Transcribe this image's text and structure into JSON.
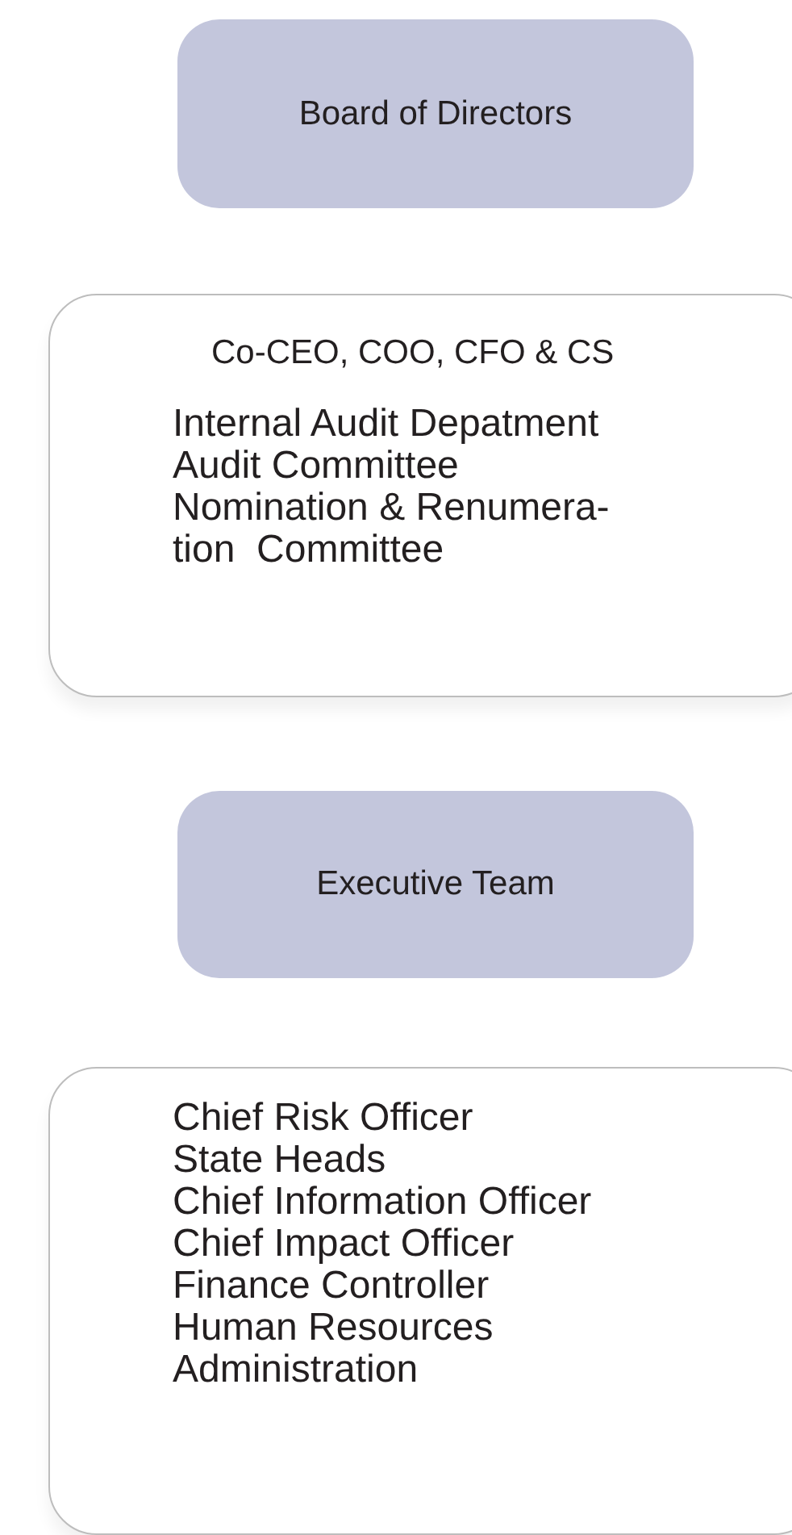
{
  "blocks": [
    {
      "kind": "pill",
      "title": "Board of Directors"
    },
    {
      "kind": "panel",
      "heading": "Co-CEO, COO, CFO & CS",
      "lines": [
        "Internal Audit Depatment",
        "Audit Committee",
        "Nomination & Renumera-",
        "tion  Committee"
      ]
    },
    {
      "kind": "pill",
      "title": "Executive Team"
    },
    {
      "kind": "panel",
      "lines": [
        "Chief Risk Officer",
        "State Heads",
        "Chief Information Officer",
        "Chief Impact Officer",
        "Finance Controller",
        "Human Resources",
        "Administration"
      ]
    }
  ]
}
